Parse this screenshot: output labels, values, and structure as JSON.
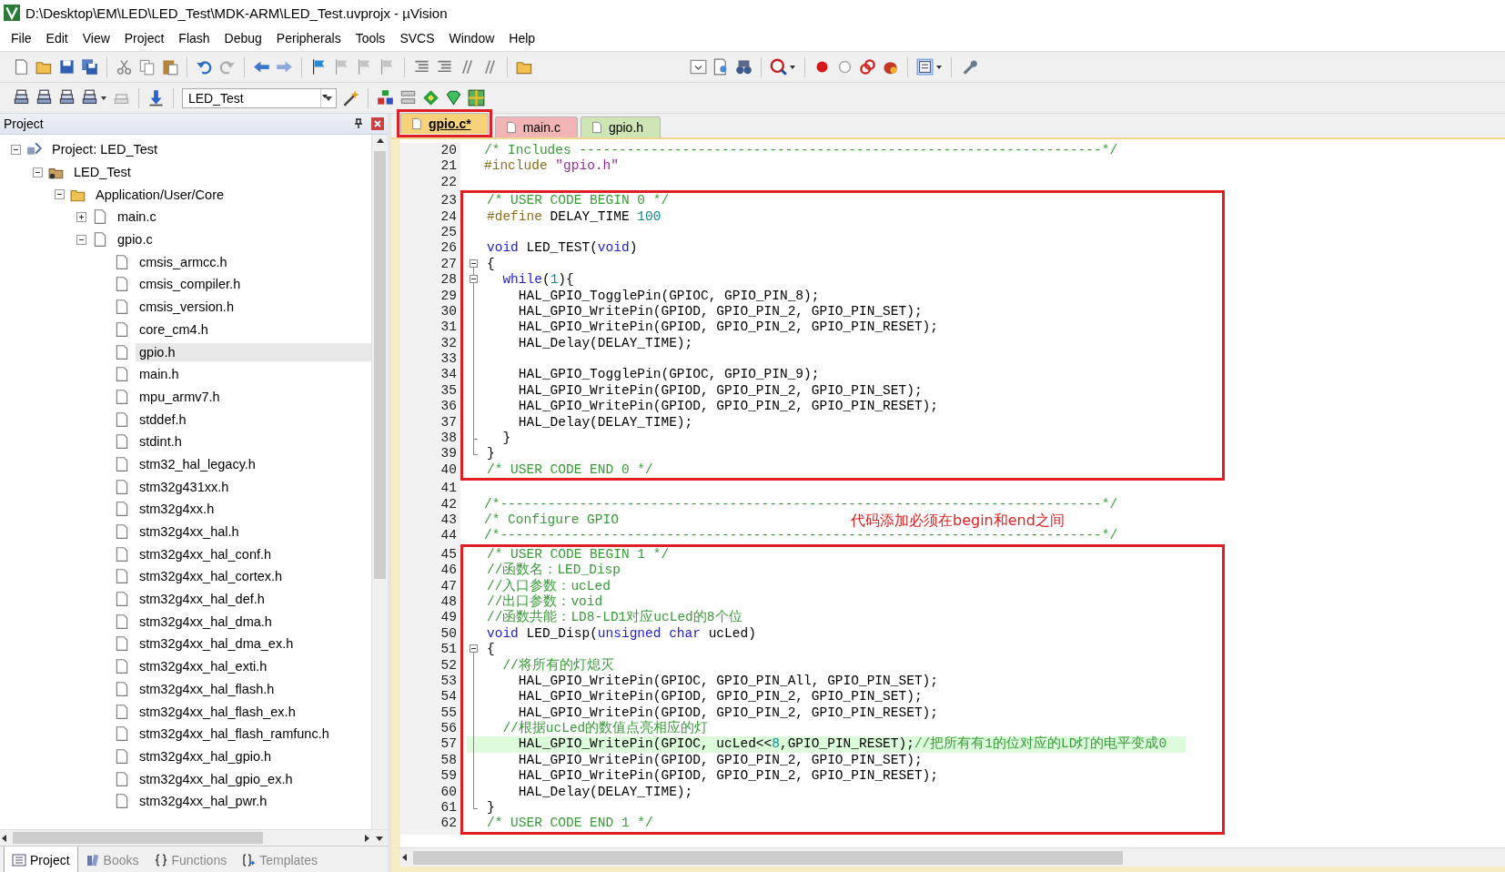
{
  "window": {
    "title": "D:\\Desktop\\EM\\LED\\LED_Test\\MDK-ARM\\LED_Test.uvprojx - µVision"
  },
  "menu": [
    "File",
    "Edit",
    "View",
    "Project",
    "Flash",
    "Debug",
    "Peripherals",
    "Tools",
    "SVCS",
    "Window",
    "Help"
  ],
  "build_toolbar": {
    "target_field": {
      "value": "LED_Test"
    }
  },
  "project_panel": {
    "title": "Project",
    "tree": [
      {
        "label": "Project: LED_Test",
        "kind": "project",
        "expanded": true,
        "selected": false,
        "children": [
          {
            "label": "LED_Test",
            "kind": "target",
            "expanded": true,
            "selected": false,
            "children": [
              {
                "label": "Application/User/Core",
                "kind": "folder",
                "expanded": true,
                "selected": false,
                "children": [
                  {
                    "label": "main.c",
                    "kind": "source",
                    "expanded": false,
                    "selected": false
                  },
                  {
                    "label": "gpio.c",
                    "kind": "source",
                    "expanded": true,
                    "selected": false,
                    "children": [
                      {
                        "label": "cmsis_armcc.h",
                        "kind": "header",
                        "selected": false
                      },
                      {
                        "label": "cmsis_compiler.h",
                        "kind": "header",
                        "selected": false
                      },
                      {
                        "label": "cmsis_version.h",
                        "kind": "header",
                        "selected": false
                      },
                      {
                        "label": "core_cm4.h",
                        "kind": "header",
                        "selected": false
                      },
                      {
                        "label": "gpio.h",
                        "kind": "header",
                        "selected": true
                      },
                      {
                        "label": "main.h",
                        "kind": "header",
                        "selected": false
                      },
                      {
                        "label": "mpu_armv7.h",
                        "kind": "header",
                        "selected": false
                      },
                      {
                        "label": "stddef.h",
                        "kind": "header",
                        "selected": false
                      },
                      {
                        "label": "stdint.h",
                        "kind": "header",
                        "selected": false
                      },
                      {
                        "label": "stm32_hal_legacy.h",
                        "kind": "header",
                        "selected": false
                      },
                      {
                        "label": "stm32g431xx.h",
                        "kind": "header",
                        "selected": false
                      },
                      {
                        "label": "stm32g4xx.h",
                        "kind": "header",
                        "selected": false
                      },
                      {
                        "label": "stm32g4xx_hal.h",
                        "kind": "header",
                        "selected": false
                      },
                      {
                        "label": "stm32g4xx_hal_conf.h",
                        "kind": "header",
                        "selected": false
                      },
                      {
                        "label": "stm32g4xx_hal_cortex.h",
                        "kind": "header",
                        "selected": false
                      },
                      {
                        "label": "stm32g4xx_hal_def.h",
                        "kind": "header",
                        "selected": false
                      },
                      {
                        "label": "stm32g4xx_hal_dma.h",
                        "kind": "header",
                        "selected": false
                      },
                      {
                        "label": "stm32g4xx_hal_dma_ex.h",
                        "kind": "header",
                        "selected": false
                      },
                      {
                        "label": "stm32g4xx_hal_exti.h",
                        "kind": "header",
                        "selected": false
                      },
                      {
                        "label": "stm32g4xx_hal_flash.h",
                        "kind": "header",
                        "selected": false
                      },
                      {
                        "label": "stm32g4xx_hal_flash_ex.h",
                        "kind": "header",
                        "selected": false
                      },
                      {
                        "label": "stm32g4xx_hal_flash_ramfunc.h",
                        "kind": "header",
                        "selected": false
                      },
                      {
                        "label": "stm32g4xx_hal_gpio.h",
                        "kind": "header",
                        "selected": false
                      },
                      {
                        "label": "stm32g4xx_hal_gpio_ex.h",
                        "kind": "header",
                        "selected": false
                      },
                      {
                        "label": "stm32g4xx_hal_pwr.h",
                        "kind": "header",
                        "selected": false
                      }
                    ]
                  }
                ]
              }
            ]
          }
        ]
      }
    ],
    "bottom_tabs": [
      {
        "label": "Project",
        "kind": "project",
        "selected": true
      },
      {
        "label": "Books",
        "kind": "books",
        "selected": false
      },
      {
        "label": "Functions",
        "kind": "functions",
        "selected": false
      },
      {
        "label": "Templates",
        "kind": "templates",
        "selected": false
      }
    ]
  },
  "editor": {
    "tabs": [
      {
        "label": "gpio.c*",
        "color": "#f8d27a",
        "selected": true,
        "framed": true
      },
      {
        "label": "main.c",
        "color": "#f2b4b4",
        "selected": false,
        "framed": false
      },
      {
        "label": "gpio.h",
        "color": "#cfe5b6",
        "selected": false,
        "framed": false
      }
    ],
    "annotation": "代码添加必须在begin和end之间",
    "blocks": [
      {
        "framed": false,
        "lines": [
          {
            "num": "20",
            "kind": "plain",
            "highlighted": false,
            "tokens": [
              {
                "kind": "comment",
                "text": "/* Includes ------------------------------------------------------------------*/"
              }
            ]
          },
          {
            "num": "21",
            "kind": "plain",
            "highlighted": false,
            "tokens": [
              {
                "kind": "preproc",
                "text": "#include"
              },
              {
                "kind": "string",
                "text": " \"gpio.h\""
              }
            ]
          },
          {
            "num": "22",
            "kind": "plain",
            "highlighted": false
          }
        ]
      },
      {
        "framed": true,
        "lines": [
          {
            "num": "23",
            "kind": "plain",
            "highlighted": false,
            "tokens": [
              {
                "kind": "comment",
                "text": "/* USER CODE BEGIN 0 */"
              }
            ]
          },
          {
            "num": "24",
            "kind": "plain",
            "highlighted": false,
            "tokens": [
              {
                "kind": "preproc",
                "text": "#define"
              },
              {
                "kind": "text",
                "text": " DELAY_TIME "
              },
              {
                "kind": "number",
                "text": "100"
              }
            ]
          },
          {
            "num": "25",
            "kind": "plain",
            "highlighted": false
          },
          {
            "num": "26",
            "kind": "plain",
            "highlighted": false,
            "tokens": [
              {
                "kind": "keyword",
                "text": "void"
              },
              {
                "kind": "text",
                "text": " LED_TEST("
              },
              {
                "kind": "keyword",
                "text": "void"
              },
              {
                "kind": "text",
                "text": ")"
              }
            ]
          },
          {
            "num": "27",
            "kind": "fold-open",
            "highlighted": false,
            "tokens": [
              {
                "kind": "text",
                "text": "{"
              }
            ]
          },
          {
            "num": "28",
            "kind": "fold-open-nested",
            "highlighted": false,
            "tokens": [
              {
                "kind": "keyword",
                "text": "  while"
              },
              {
                "kind": "text",
                "text": "("
              },
              {
                "kind": "number",
                "text": "1"
              },
              {
                "kind": "text",
                "text": "){"
              }
            ]
          },
          {
            "num": "29",
            "kind": "fold-line",
            "highlighted": false,
            "tokens": [
              {
                "kind": "text",
                "text": "    HAL_GPIO_TogglePin(GPIOC, GPIO_PIN_8);"
              }
            ]
          },
          {
            "num": "30",
            "kind": "fold-line",
            "highlighted": false,
            "tokens": [
              {
                "kind": "text",
                "text": "    HAL_GPIO_WritePin(GPIOD, GPIO_PIN_2, GPIO_PIN_SET);"
              }
            ]
          },
          {
            "num": "31",
            "kind": "fold-line",
            "highlighted": false,
            "tokens": [
              {
                "kind": "text",
                "text": "    HAL_GPIO_WritePin(GPIOD, GPIO_PIN_2, GPIO_PIN_RESET);"
              }
            ]
          },
          {
            "num": "32",
            "kind": "fold-line",
            "highlighted": false,
            "tokens": [
              {
                "kind": "text",
                "text": "    HAL_Delay(DELAY_TIME);"
              }
            ]
          },
          {
            "num": "33",
            "kind": "fold-line",
            "highlighted": false
          },
          {
            "num": "34",
            "kind": "fold-line",
            "highlighted": false,
            "tokens": [
              {
                "kind": "text",
                "text": "    HAL_GPIO_TogglePin(GPIOC, GPIO_PIN_9);"
              }
            ]
          },
          {
            "num": "35",
            "kind": "fold-line",
            "highlighted": false,
            "tokens": [
              {
                "kind": "text",
                "text": "    HAL_GPIO_WritePin(GPIOD, GPIO_PIN_2, GPIO_PIN_SET);"
              }
            ]
          },
          {
            "num": "36",
            "kind": "fold-line",
            "highlighted": false,
            "tokens": [
              {
                "kind": "text",
                "text": "    HAL_GPIO_WritePin(GPIOD, GPIO_PIN_2, GPIO_PIN_RESET);"
              }
            ]
          },
          {
            "num": "37",
            "kind": "fold-line",
            "highlighted": false,
            "tokens": [
              {
                "kind": "text",
                "text": "    HAL_Delay(DELAY_TIME);"
              }
            ]
          },
          {
            "num": "38",
            "kind": "fold-branch-end",
            "highlighted": false,
            "tokens": [
              {
                "kind": "text",
                "text": "  }"
              }
            ]
          },
          {
            "num": "39",
            "kind": "fold-end",
            "highlighted": false,
            "tokens": [
              {
                "kind": "text",
                "text": "}"
              }
            ]
          },
          {
            "num": "40",
            "kind": "plain",
            "highlighted": false,
            "tokens": [
              {
                "kind": "comment",
                "text": "/* USER CODE END 0 */"
              }
            ]
          }
        ]
      },
      {
        "framed": false,
        "lines": [
          {
            "num": "41",
            "kind": "plain",
            "highlighted": false
          },
          {
            "num": "42",
            "kind": "plain",
            "highlighted": false,
            "tokens": [
              {
                "kind": "comment",
                "text": "/*----------------------------------------------------------------------------*/"
              }
            ]
          },
          {
            "num": "43",
            "kind": "plain",
            "highlighted": false,
            "tokens": [
              {
                "kind": "comment",
                "text": "/* Configure GPIO"
              }
            ]
          },
          {
            "num": "44",
            "kind": "plain",
            "highlighted": false,
            "tokens": [
              {
                "kind": "comment",
                "text": "/*----------------------------------------------------------------------------*/"
              }
            ]
          }
        ]
      },
      {
        "framed": true,
        "lines": [
          {
            "num": "45",
            "kind": "plain",
            "highlighted": false,
            "tokens": [
              {
                "kind": "comment",
                "text": "/* USER CODE BEGIN 1 */"
              }
            ]
          },
          {
            "num": "46",
            "kind": "plain",
            "highlighted": false,
            "tokens": [
              {
                "kind": "comment",
                "text": "//函数名：LED_Disp"
              }
            ]
          },
          {
            "num": "47",
            "kind": "plain",
            "highlighted": false,
            "tokens": [
              {
                "kind": "comment",
                "text": "//入口参数：ucLed"
              }
            ]
          },
          {
            "num": "48",
            "kind": "plain",
            "highlighted": false,
            "tokens": [
              {
                "kind": "comment",
                "text": "//出口参数：void"
              }
            ]
          },
          {
            "num": "49",
            "kind": "plain",
            "highlighted": false,
            "tokens": [
              {
                "kind": "comment",
                "text": "//函数共能：LD8-LD1对应ucLed的8个位"
              }
            ]
          },
          {
            "num": "50",
            "kind": "plain",
            "highlighted": false,
            "tokens": [
              {
                "kind": "keyword",
                "text": "void"
              },
              {
                "kind": "text",
                "text": " LED_Disp("
              },
              {
                "kind": "keyword",
                "text": "unsigned char"
              },
              {
                "kind": "text",
                "text": " ucLed)"
              }
            ]
          },
          {
            "num": "51",
            "kind": "fold-open",
            "highlighted": false,
            "tokens": [
              {
                "kind": "text",
                "text": "{"
              }
            ]
          },
          {
            "num": "52",
            "kind": "fold-line",
            "highlighted": false,
            "tokens": [
              {
                "kind": "comment",
                "text": "  //将所有的灯熄灭"
              }
            ]
          },
          {
            "num": "53",
            "kind": "fold-line",
            "highlighted": false,
            "tokens": [
              {
                "kind": "text",
                "text": "    HAL_GPIO_WritePin(GPIOC, GPIO_PIN_All, GPIO_PIN_SET);"
              }
            ]
          },
          {
            "num": "54",
            "kind": "fold-line",
            "highlighted": false,
            "tokens": [
              {
                "kind": "text",
                "text": "    HAL_GPIO_WritePin(GPIOD, GPIO_PIN_2, GPIO_PIN_SET);"
              }
            ]
          },
          {
            "num": "55",
            "kind": "fold-line",
            "highlighted": false,
            "tokens": [
              {
                "kind": "text",
                "text": "    HAL_GPIO_WritePin(GPIOD, GPIO_PIN_2, GPIO_PIN_RESET);"
              }
            ]
          },
          {
            "num": "56",
            "kind": "fold-line",
            "highlighted": false,
            "tokens": [
              {
                "kind": "comment",
                "text": "  //根据ucLed的数值点亮相应的灯"
              }
            ]
          },
          {
            "num": "57",
            "kind": "fold-line",
            "highlighted": true,
            "tokens": [
              {
                "kind": "text",
                "text": "    HAL_GPIO_WritePin(GPIOC, ucLed<<"
              },
              {
                "kind": "number",
                "text": "8"
              },
              {
                "kind": "text",
                "text": ",GPIO_PIN_RESET);"
              },
              {
                "kind": "comment",
                "text": "//把所有有1的位对应的LD灯的电平变成0"
              }
            ]
          },
          {
            "num": "58",
            "kind": "fold-line",
            "highlighted": false,
            "tokens": [
              {
                "kind": "text",
                "text": "    HAL_GPIO_WritePin(GPIOD, GPIO_PIN_2, GPIO_PIN_SET);"
              }
            ]
          },
          {
            "num": "59",
            "kind": "fold-line",
            "highlighted": false,
            "tokens": [
              {
                "kind": "text",
                "text": "    HAL_GPIO_WritePin(GPIOD, GPIO_PIN_2, GPIO_PIN_RESET);"
              }
            ]
          },
          {
            "num": "60",
            "kind": "fold-line",
            "highlighted": false,
            "tokens": [
              {
                "kind": "text",
                "text": "    HAL_Delay(DELAY_TIME);"
              }
            ]
          },
          {
            "num": "61",
            "kind": "fold-end",
            "highlighted": false,
            "tokens": [
              {
                "kind": "text",
                "text": "}"
              }
            ]
          },
          {
            "num": "62",
            "kind": "plain",
            "highlighted": false,
            "tokens": [
              {
                "kind": "comment",
                "text": "/* USER CODE END 1 */"
              }
            ]
          }
        ]
      }
    ]
  }
}
